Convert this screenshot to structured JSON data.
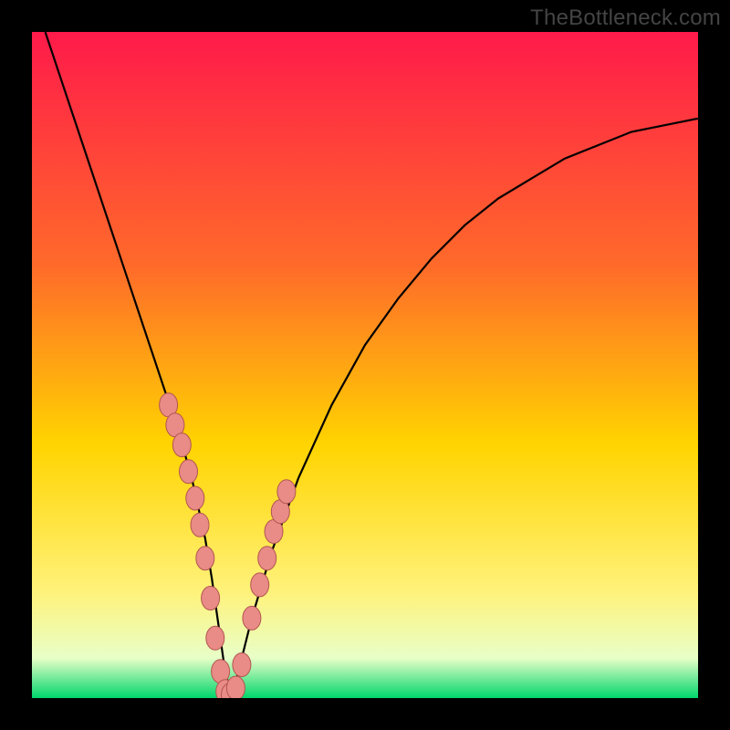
{
  "watermark": "TheBottleneck.com",
  "colors": {
    "frame_bg": "#000000",
    "grad_top": "#ff1a4a",
    "grad_mid1": "#ff6a2a",
    "grad_mid2": "#ffd400",
    "grad_mid3": "#fff27a",
    "grad_mid4": "#e8ffc8",
    "grad_bottom": "#00d66b",
    "curve_stroke": "#000000",
    "marker_fill": "#e98b86",
    "marker_stroke": "#b25650"
  },
  "chart_data": {
    "type": "line",
    "title": "",
    "xlabel": "",
    "ylabel": "",
    "xlim": [
      0,
      100
    ],
    "ylim": [
      0,
      100
    ],
    "series": [
      {
        "name": "bottleneck-curve",
        "x": [
          2,
          4,
          6,
          8,
          10,
          12,
          14,
          16,
          18,
          20,
          22,
          24,
          26,
          27,
          28,
          29,
          30,
          31,
          33,
          36,
          40,
          45,
          50,
          55,
          60,
          65,
          70,
          75,
          80,
          85,
          90,
          95,
          100
        ],
        "y": [
          100,
          94,
          88,
          82,
          76,
          70,
          64,
          58,
          52,
          46,
          40,
          33,
          24,
          18,
          11,
          4,
          0,
          4,
          12,
          22,
          33,
          44,
          53,
          60,
          66,
          71,
          75,
          78,
          81,
          83,
          85,
          86,
          87
        ]
      }
    ],
    "markers": {
      "name": "highlighted-points",
      "x": [
        20.5,
        21.5,
        22.5,
        23.5,
        24.5,
        25.2,
        26.0,
        26.8,
        27.5,
        28.3,
        29.0,
        29.8,
        30.6,
        31.5,
        33.0,
        34.2,
        35.3,
        36.3,
        37.3,
        38.2
      ],
      "y": [
        44,
        41,
        38,
        34,
        30,
        26,
        21,
        15,
        9,
        4,
        1,
        0.5,
        1.5,
        5,
        12,
        17,
        21,
        25,
        28,
        31
      ]
    }
  }
}
